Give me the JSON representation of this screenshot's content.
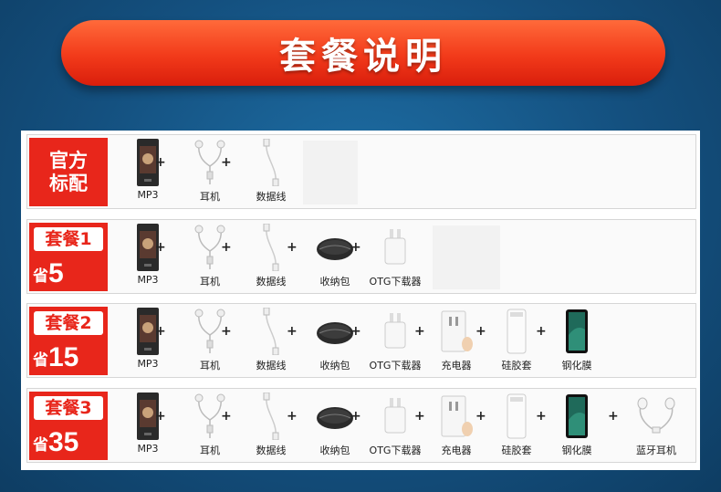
{
  "banner": {
    "title": "套餐说明"
  },
  "rows": [
    {
      "tag_text": "官方\n标配",
      "items": [
        "MP3",
        "耳机",
        "数据线"
      ]
    },
    {
      "tag_top": "套餐1",
      "save_label": "省",
      "save_amount": "5",
      "items": [
        "MP3",
        "耳机",
        "数据线",
        "收纳包",
        "OTG下载器"
      ]
    },
    {
      "tag_top": "套餐2",
      "save_label": "省",
      "save_amount": "15",
      "items": [
        "MP3",
        "耳机",
        "数据线",
        "收纳包",
        "OTG下载器",
        "充电器",
        "硅胶套",
        "钢化膜"
      ]
    },
    {
      "tag_top": "套餐3",
      "save_label": "省",
      "save_amount": "35",
      "items": [
        "MP3",
        "耳机",
        "数据线",
        "收纳包",
        "OTG下载器",
        "充电器",
        "硅胶套",
        "钢化膜",
        "蓝牙耳机"
      ]
    }
  ],
  "plus_sign": "+",
  "icons": [
    "mp3-player-icon",
    "earphones-icon",
    "usb-cable-icon",
    "storage-pouch-icon",
    "otg-adapter-icon",
    "charger-icon",
    "silicone-case-icon",
    "tempered-glass-icon",
    "bluetooth-earphones-icon"
  ]
}
